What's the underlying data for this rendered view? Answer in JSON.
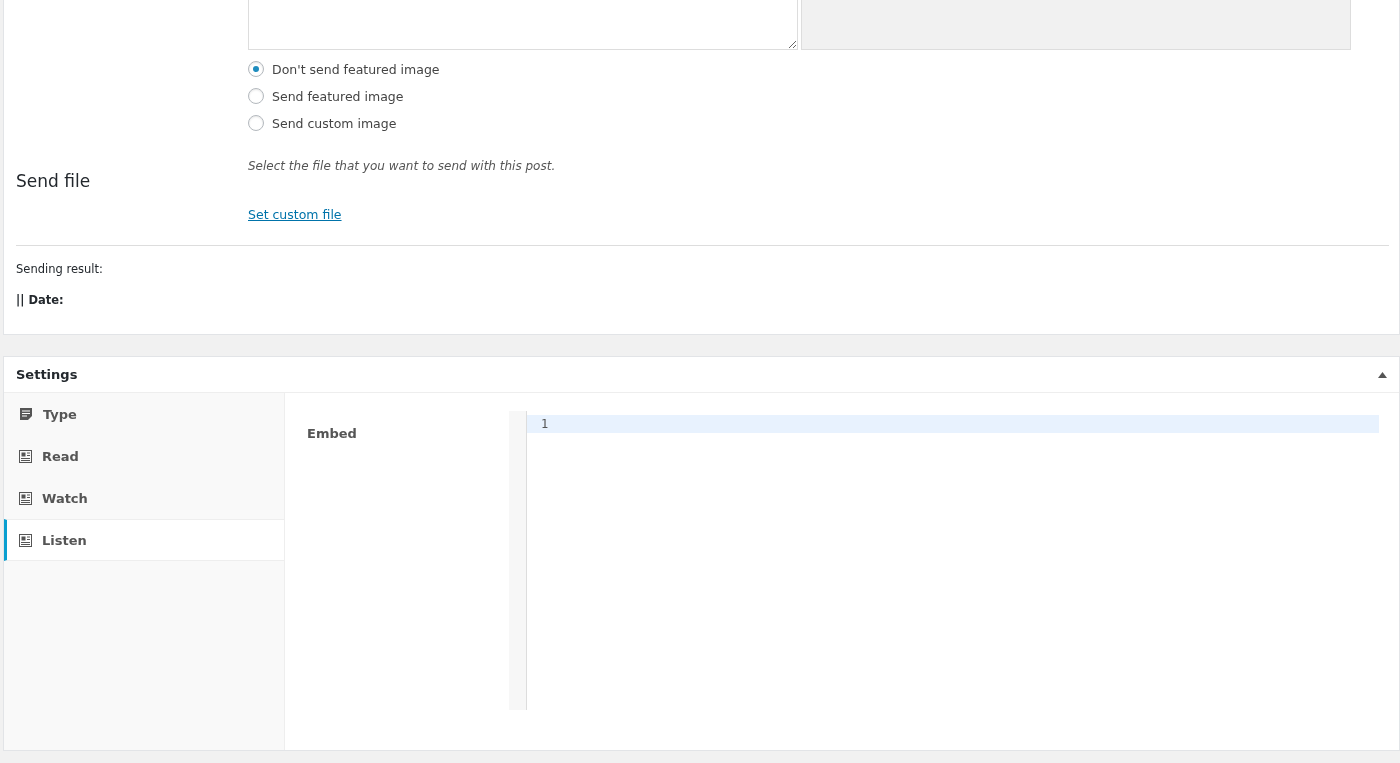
{
  "image_options": [
    {
      "label": "Don't send featured image",
      "selected": true
    },
    {
      "label": "Send featured image",
      "selected": false
    },
    {
      "label": "Send custom image",
      "selected": false
    }
  ],
  "send_file": {
    "heading": "Send file",
    "description": "Select the file that you want to send with this post.",
    "link": "Set custom file"
  },
  "sending_result": {
    "label": "Sending result:",
    "date_label": "|| Date:"
  },
  "settings": {
    "title": "Settings",
    "expanded": true,
    "tabs": [
      {
        "label": "Type",
        "kind": "form",
        "selected": false
      },
      {
        "label": "Read",
        "kind": "card",
        "selected": false
      },
      {
        "label": "Watch",
        "kind": "card",
        "selected": false
      },
      {
        "label": "Listen",
        "kind": "card",
        "selected": true
      }
    ],
    "embed_label": "Embed",
    "line_numbers": [
      "1"
    ]
  }
}
